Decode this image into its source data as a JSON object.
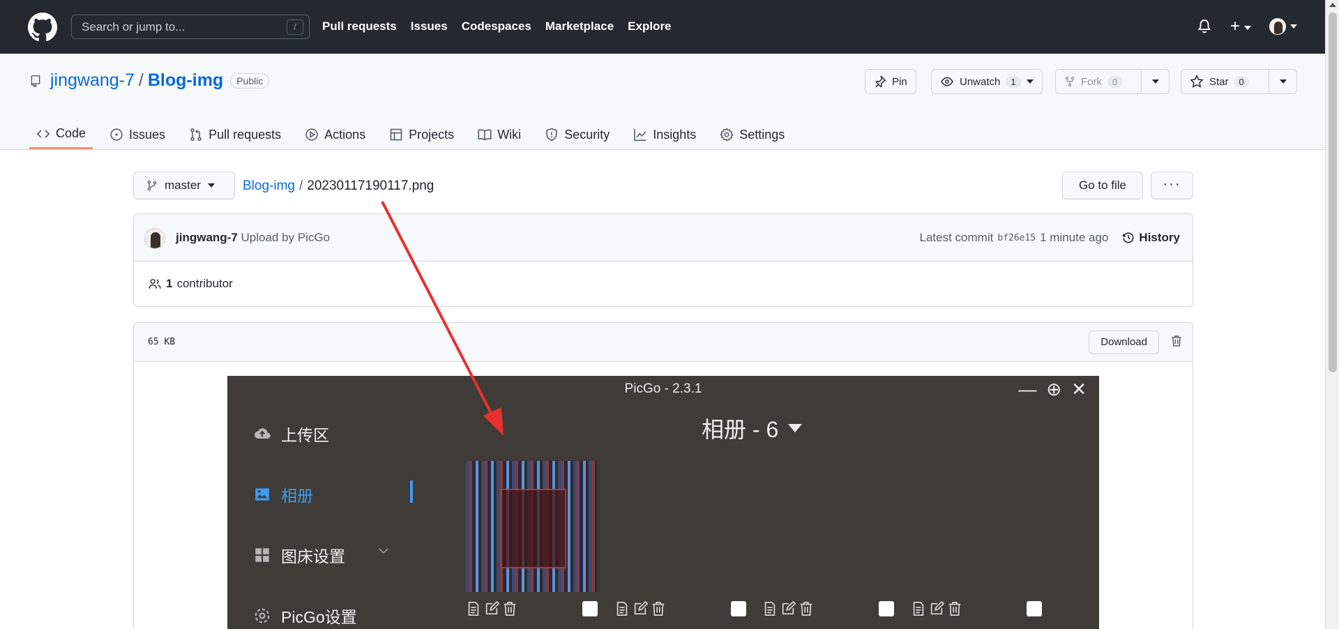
{
  "header": {
    "search_placeholder": "Search or jump to...",
    "search_shortcut": "/",
    "nav": [
      "Pull requests",
      "Issues",
      "Codespaces",
      "Marketplace",
      "Explore"
    ],
    "plus": "+"
  },
  "repo": {
    "owner": "jingwang-7",
    "separator": "/",
    "name": "Blog-img",
    "visibility": "Public",
    "pin_label": "Pin",
    "unwatch_label": "Unwatch",
    "watch_count": "1",
    "fork_label": "Fork",
    "fork_count": "0",
    "star_label": "Star",
    "star_count": "0"
  },
  "tabs": [
    {
      "label": "Code",
      "icon": "code-icon"
    },
    {
      "label": "Issues",
      "icon": "issue-icon"
    },
    {
      "label": "Pull requests",
      "icon": "pull-request-icon"
    },
    {
      "label": "Actions",
      "icon": "play-icon"
    },
    {
      "label": "Projects",
      "icon": "table-icon"
    },
    {
      "label": "Wiki",
      "icon": "book-icon"
    },
    {
      "label": "Security",
      "icon": "shield-icon"
    },
    {
      "label": "Insights",
      "icon": "graph-icon"
    },
    {
      "label": "Settings",
      "icon": "gear-icon"
    }
  ],
  "file": {
    "branch": "master",
    "crumb_repo": "Blog-img",
    "crumb_sep": "/",
    "filename": "20230117190117.png",
    "goto_file": "Go to file",
    "more": "···",
    "size": "65 KB",
    "download": "Download"
  },
  "commit": {
    "author": "jingwang-7",
    "message": "Upload by PicGo",
    "latest_label": "Latest commit",
    "sha": "bf26e15",
    "time": "1 minute ago",
    "history": "History",
    "contributors_count": "1",
    "contributors_label": "contributor"
  },
  "picgo": {
    "title": "PicGo - 2.3.1",
    "controls": [
      "—",
      "⊕",
      "✕"
    ],
    "sidebar": [
      "上传区",
      "相册",
      "图床设置",
      "PicGo设置"
    ],
    "heading": "相册 - 6"
  },
  "colors": {
    "header_bg": "#24292f",
    "link": "#0969da",
    "tab_underline": "#fd8c73",
    "picgo_bg": "#3f3b36",
    "picgo_accent": "#3d9cf0",
    "arrow": "#e8302f"
  }
}
